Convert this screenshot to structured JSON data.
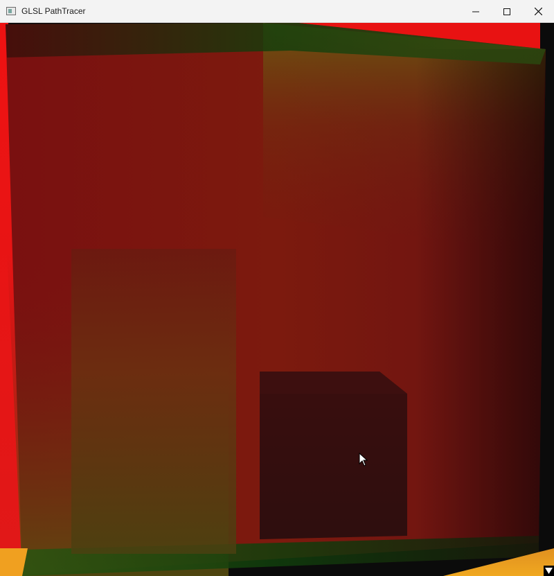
{
  "window": {
    "title": "GLSL PathTracer",
    "controls": {
      "minimize_icon": "minimize-icon",
      "maximize_icon": "maximize-icon",
      "close_icon": "close-icon"
    }
  },
  "scene": {
    "description_icon": "render-viewport",
    "colors": {
      "left_wall": "#e81212",
      "back_wall": "#7a1010",
      "back_wall_right": "#6a5a10",
      "floor_light": "#f0a020",
      "floor_green": "#1f5a12",
      "ceiling_green": "#103e0c",
      "tall_box": "#5a2a10",
      "short_box": "#3a1010",
      "background": "#0b0b0b"
    }
  },
  "overlay": {
    "dropdown_icon": "triangle-down-icon"
  }
}
